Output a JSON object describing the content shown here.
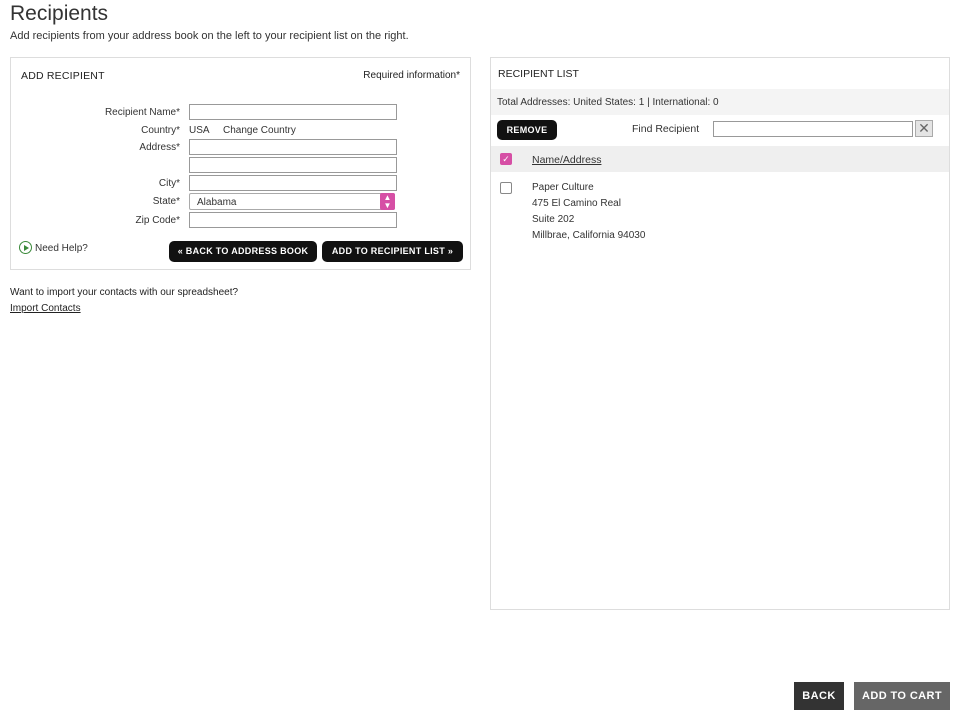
{
  "page": {
    "title": "Recipients",
    "subtitle": "Add recipients from your address book on the left to your recipient list on the right."
  },
  "add_recipient": {
    "title": "ADD RECIPIENT",
    "required_note": "Required information*",
    "labels": {
      "name": "Recipient Name*",
      "country": "Country*",
      "address": "Address*",
      "city": "City*",
      "state": "State*",
      "zip": "Zip Code*"
    },
    "country_value": "USA",
    "change_country": "Change Country",
    "state_value": "Alabama",
    "need_help": "Need Help?",
    "back_button": "« BACK TO ADDRESS BOOK",
    "add_button": "ADD TO RECIPIENT LIST »"
  },
  "import": {
    "question": "Want to import your contacts with our spreadsheet?",
    "link": "Import Contacts"
  },
  "recipient_list": {
    "title": "RECIPIENT LIST",
    "totals": "Total Addresses: United States: 1 | International: 0",
    "remove_button": "REMOVE",
    "find_label": "Find Recipient",
    "column_header": "Name/Address",
    "entries": [
      {
        "line1": "Paper Culture",
        "line2": "475 El Camino Real",
        "line3": "Suite 202",
        "line4": "Millbrae, California 94030"
      }
    ]
  },
  "footer": {
    "back": "BACK",
    "add_to_cart": "ADD TO CART"
  },
  "colors": {
    "accent": "#d64fa5",
    "button_dark": "#111111"
  }
}
